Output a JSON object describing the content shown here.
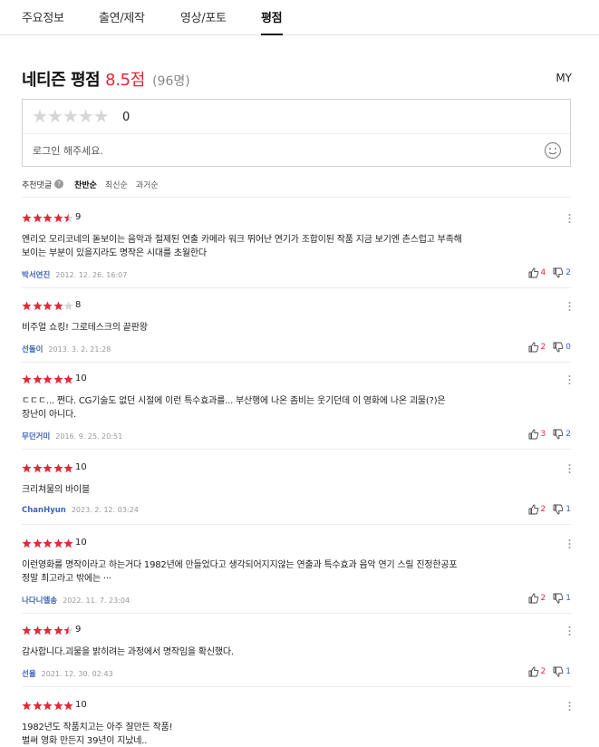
{
  "tabs": [
    "주요정보",
    "출연/제작",
    "영상/포토",
    "평점"
  ],
  "header": {
    "title": "네티즌 평점",
    "score": "8.5점",
    "count": "(96명)",
    "my_label": "MY"
  },
  "rate_box": {
    "stars_glyphs": "★★★★★",
    "value": "0",
    "login_prompt": "로그인 해주세요."
  },
  "sort": {
    "label": "추천댓글",
    "help": "?",
    "options": [
      "찬반순",
      "최신순",
      "과거순"
    ],
    "active": "찬반순"
  },
  "colors": {
    "star": "#e2283a",
    "author": "#3e64b6",
    "score": "#e2283a"
  },
  "reviews": [
    {
      "rating": 9,
      "score": "9",
      "lines": [
        "엔리오 모리코네의 돋보이는 음악과 절제된 연출 카메라 워크 뛰어난 연기가 조합이된 작품 지금 보기엔 촌스럽고 부족해",
        "보이는 부분이 있을지라도 명작은 시대를 초월한다"
      ],
      "author": "박서연진",
      "date": "2012. 12. 26. 16:07",
      "up": "4",
      "down": "2"
    },
    {
      "rating": 8,
      "score": "8",
      "lines": [
        "비주얼 쇼킹! 그로테스크의 끝판왕"
      ],
      "author": "선돌이",
      "date": "2013. 3. 2. 21:28",
      "up": "2",
      "down": "0"
    },
    {
      "rating": 10,
      "score": "10",
      "lines": [
        "ㄷㄷㄷ... 쩐다. CG기술도 없던 시절에 이런 특수효과를... 부산행에 나온 좀비는 웃기던데 이 영화에 나온 괴물(?)은",
        "장난이 아니다."
      ],
      "author": "무던거미",
      "date": "2016. 9. 25. 20:51",
      "up": "3",
      "down": "2"
    },
    {
      "rating": 10,
      "score": "10",
      "lines": [
        "크리쳐물의 바이블"
      ],
      "author": "ChanHyun",
      "date": "2023. 2. 12. 03:24",
      "up": "2",
      "down": "1"
    },
    {
      "rating": 10,
      "score": "10",
      "lines": [
        "이런영화를 명작이라고 하는거다 1982년에 만들었다고 생각되어지지않는 연출과 특수효과 음악 연기 스릴 진정한공포",
        "정말 최고라고 밖에는 ···"
      ],
      "author": "나다니엘송",
      "date": "2022. 11. 7. 23:04",
      "up": "2",
      "down": "1"
    },
    {
      "rating": 9,
      "score": "9",
      "lines": [
        "감사합니다.괴물을 밝히려는 과정에서 명작임을 확신했다."
      ],
      "author": "선율",
      "date": "2021. 12. 30. 02:43",
      "up": "2",
      "down": "1"
    },
    {
      "rating": 10,
      "score": "10",
      "lines": [
        "1982년도 작품치고는 아주 잘만든 작품!",
        "벌써 영화 만든지 39년이 지났네.."
      ],
      "author": "",
      "date": "",
      "up": "",
      "down": ""
    }
  ]
}
